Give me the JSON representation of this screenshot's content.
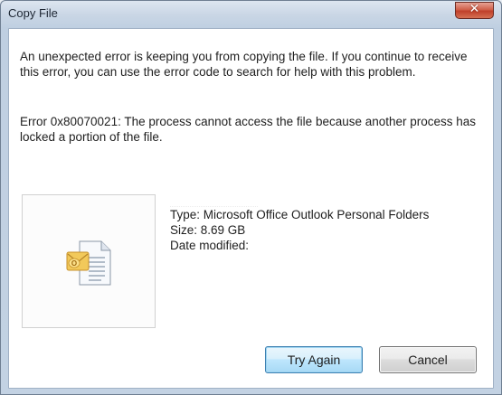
{
  "window": {
    "title": "Copy File",
    "close_glyph": "✕"
  },
  "message": {
    "intro": "An unexpected error is keeping you from copying the file. If you continue to receive this error, you can use the error code to search for help with this problem.",
    "error": "Error 0x80070021: The process cannot access the file because another process has locked a portion of the file."
  },
  "file": {
    "icon": "outlook-pst-file-icon",
    "type": "Type: Microsoft Office Outlook Personal Folders",
    "size": "Size: 8.69 GB",
    "date_label": "Date modified:"
  },
  "buttons": {
    "try_again": "Try Again",
    "cancel": "Cancel"
  },
  "colors": {
    "accent_button_border": "#3c7fb1",
    "close_button": "#c0402a"
  }
}
